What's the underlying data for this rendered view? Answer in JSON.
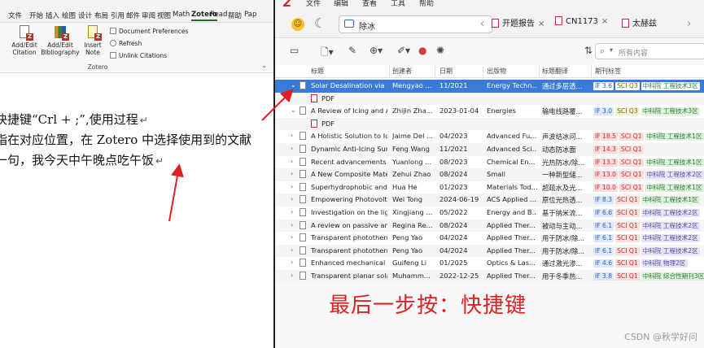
{
  "word": {
    "tabs": [
      "文件",
      "开始",
      "插入",
      "绘图",
      "设计",
      "布局",
      "引用",
      "邮件",
      "审阅",
      "视图",
      "Math",
      "Zotero",
      "Read",
      "帮助",
      "Pap"
    ],
    "active_tab": "Zotero",
    "ribbon": {
      "add_edit_citation": "Add/Edit Citation",
      "add_edit_bibliography": "Add/Edit Bibliography",
      "insert_note": "Insert Note",
      "document_preferences": "Document Preferences",
      "refresh": "Refresh",
      "unlink_citations": "Unlink Citations",
      "group_label": "Zotero"
    },
    "body_lines": [
      "快捷键“Crl + ;”,使用过程",
      "指在对应位置，在 Zotero 中选择使用到的文献",
      "一句，我今天中午晚点吃午饭"
    ]
  },
  "zotero": {
    "logo": "Z",
    "menu": [
      "文件",
      "编辑",
      "查看",
      "工具",
      "帮助"
    ],
    "collection_tab": "除冰",
    "reader_tabs": [
      "开题报告",
      "CN1173",
      "太赫兹"
    ],
    "search_placeholder": "所有内容",
    "columns": [
      "标题",
      "创建者",
      "日期",
      "出版物",
      "标题翻译",
      "期刊标签"
    ],
    "rows": [
      {
        "expanded": true,
        "selected": true,
        "title": "Solar Desalination via M",
        "creator": "Mengyao ...",
        "date": "11/2021",
        "publication": "Energy Techn...",
        "translation": "通过多层透...",
        "tags": [
          "IF 3.6",
          "SCI Q3",
          "中科院 工程技术3区"
        ]
      },
      {
        "attachment": true,
        "title": "PDF"
      },
      {
        "expanded": true,
        "title": "A Review of Icing and A",
        "creator": "Zhijin Zha...",
        "date": "2023-01-04",
        "publication": "Energies",
        "translation": "输电线路覆...",
        "tags": [
          "IF 3.0",
          "SCI Q3",
          "中科院 工程技术3区"
        ]
      },
      {
        "attachment": true,
        "title": "PDF"
      },
      {
        "title": "A Holistic Solution to Ic",
        "creator": "Jaime Del ...",
        "date": "04/2023",
        "publication": "Advanced Fu...",
        "translation": "声波结冰问...",
        "tags": [
          "IF 18.5",
          "SCI Q1",
          "中科院 工程技术1区"
        ]
      },
      {
        "title": "Dynamic Anti-Icing Surf",
        "creator": "Feng Wang",
        "date": "11/2021",
        "publication": "Advanced Sci...",
        "translation": "动态防冰面",
        "tags": [
          "IF 14.3",
          "SCI Q1"
        ]
      },
      {
        "title": "Recent advancements in",
        "creator": "Yuanlong ...",
        "date": "08/2023",
        "publication": "Chemical En...",
        "translation": "光热防冰/除...",
        "tags": [
          "IF 13.3",
          "SCI Q1",
          "中科院 工程技术1区"
        ]
      },
      {
        "title": "A New Composite Mate",
        "creator": "Zehui Zhao",
        "date": "08/2024",
        "publication": "Small",
        "translation": "一种新型储...",
        "tags": [
          "IF 13.0",
          "SCI Q1",
          "中科院 工程技术2区"
        ]
      },
      {
        "title": "Superhydrophobic and",
        "creator": "Hua He",
        "date": "01/2023",
        "publication": "Materials Tod...",
        "translation": "超疏水及光...",
        "tags": [
          "IF 10.0",
          "SCI Q1",
          "中科院 工程技术1区"
        ]
      },
      {
        "title": "Empowering Photovolta",
        "creator": "Wei Tong",
        "date": "2024-06-19",
        "publication": "ACS Applied ...",
        "translation": "原位光热透...",
        "tags": [
          "IF 8.3",
          "SCI Q1",
          "中科院 工程技术1区"
        ]
      },
      {
        "title": "Investigation on the ligl",
        "creator": "Xingjiang ...",
        "date": "05/2022",
        "publication": "Energy and B...",
        "translation": "基于纳米流...",
        "tags": [
          "IF 6.6",
          "SCI Q1",
          "中科院 工程技术2区"
        ]
      },
      {
        "title": "A review on passive and",
        "creator": "Regina Re...",
        "date": "08/2024",
        "publication": "Applied Ther...",
        "translation": "被动与主动...",
        "tags": [
          "IF 6.1",
          "SCI Q1",
          "中科院 工程技术2区"
        ]
      },
      {
        "title": "Transparent photothern",
        "creator": "Peng Yao",
        "date": "04/2024",
        "publication": "Applied Ther...",
        "translation": "用于防冰/除...",
        "tags": [
          "IF 6.1",
          "SCI Q1",
          "中科院 工程技术2区"
        ]
      },
      {
        "title": "Transparent photothern",
        "creator": "Peng Yao",
        "date": "04/2024",
        "publication": "Applied Ther...",
        "translation": "用于防冰/除...",
        "tags": [
          "IF 6.1",
          "SCI Q1",
          "中科院 工程技术2区"
        ]
      },
      {
        "title": "Enhanced mechanical d",
        "creator": "Guifeng Li",
        "date": "01/2025",
        "publication": "Optics & Las...",
        "translation": "通过激光渗...",
        "tags": [
          "IF 4.6",
          "SCI Q1",
          "中科院 物理2区"
        ]
      },
      {
        "title": "Transparent planar sola",
        "creator": "Muhamm...",
        "date": "2022-12-25",
        "publication": "Applied Ther...",
        "translation": "用于冬季热...",
        "tags": [
          "IF 3.8",
          "SCI Q1",
          "中科院 综合性期刊3区"
        ]
      }
    ],
    "caption": "最后一步按：快捷键",
    "watermark": "CSDN @秋学好问"
  }
}
